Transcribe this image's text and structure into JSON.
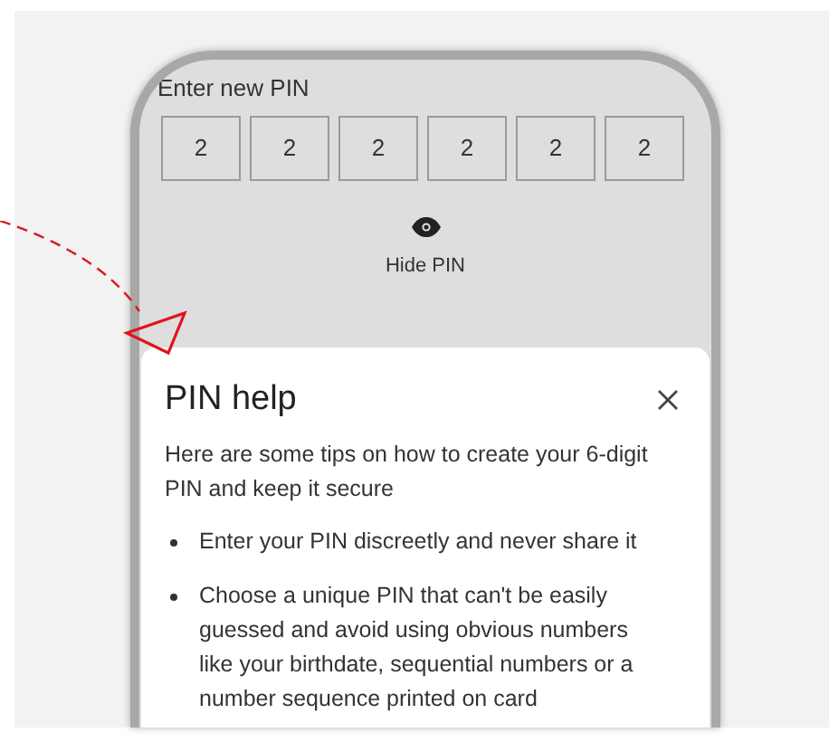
{
  "pin_entry": {
    "label": "Enter new PIN",
    "digits": [
      "2",
      "2",
      "2",
      "2",
      "2",
      "2"
    ],
    "toggle": {
      "label": "Hide PIN"
    }
  },
  "help_sheet": {
    "title": "PIN help",
    "intro": "Here are some tips on how to create your 6-digit PIN and keep it secure",
    "tips": [
      "Enter your PIN discreetly and never share it",
      "Choose a unique PIN that can't be easily guessed and avoid using obvious numbers like your birthdate, sequential numbers or a number sequence printed on card"
    ]
  }
}
